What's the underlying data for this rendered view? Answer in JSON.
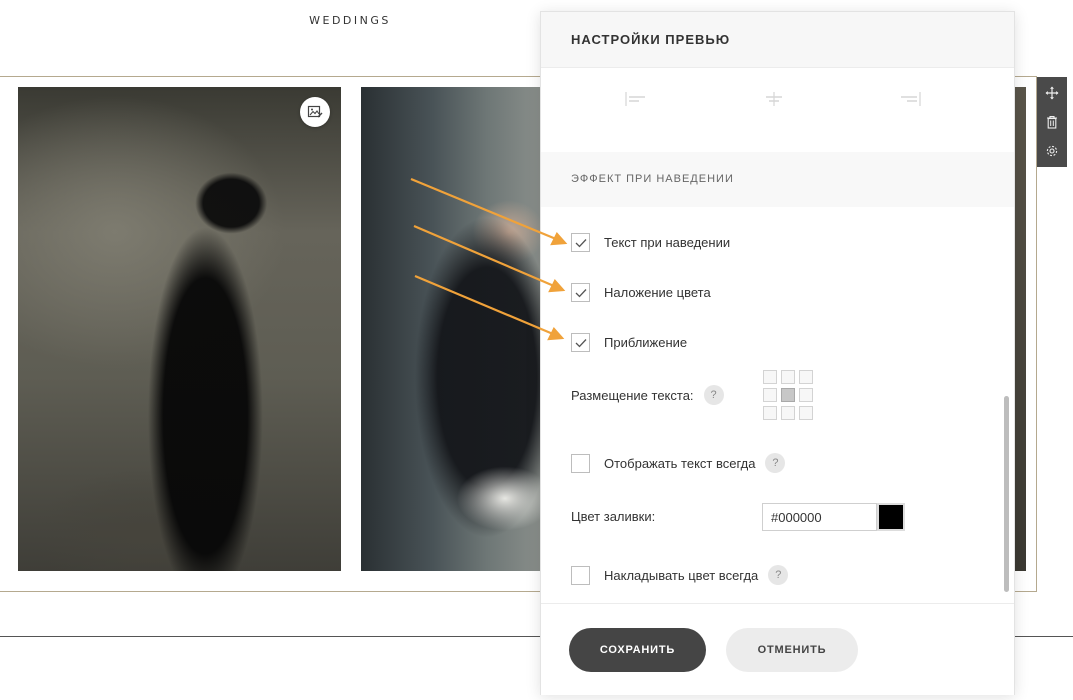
{
  "site": {
    "title": "WEDDINGS"
  },
  "panel": {
    "title": "НАСТРОЙКИ ПРЕВЬЮ",
    "hover_section": {
      "title": "ЭФФЕКТ ПРИ НАВЕДЕНИИ",
      "checkbox_hover_text": {
        "label": "Текст при наведении",
        "checked": true
      },
      "checkbox_color_overlay": {
        "label": "Наложение цвета",
        "checked": true
      },
      "checkbox_zoom": {
        "label": "Приближение",
        "checked": true
      },
      "text_position": {
        "label": "Размещение текста:",
        "help": "?",
        "selected": "center"
      },
      "checkbox_always_text": {
        "label": "Отображать текст всегда",
        "checked": false,
        "help": "?"
      },
      "fill_color": {
        "label": "Цвет заливки:",
        "value": "#000000",
        "swatch": "#000000"
      },
      "checkbox_always_color": {
        "label": "Накладывать цвет всегда",
        "checked": false,
        "help": "?"
      }
    },
    "footer": {
      "save_label": "СОХРАНИТЬ",
      "cancel_label": "ОТМЕНИТЬ"
    }
  },
  "toolbar": {
    "icons": [
      "move-icon",
      "trash-icon",
      "gear-icon"
    ]
  },
  "colors": {
    "accent_arrow": "#f0a23a",
    "save_button": "#454545",
    "cancel_button": "#ececec",
    "frame_border": "#b5a98f"
  }
}
